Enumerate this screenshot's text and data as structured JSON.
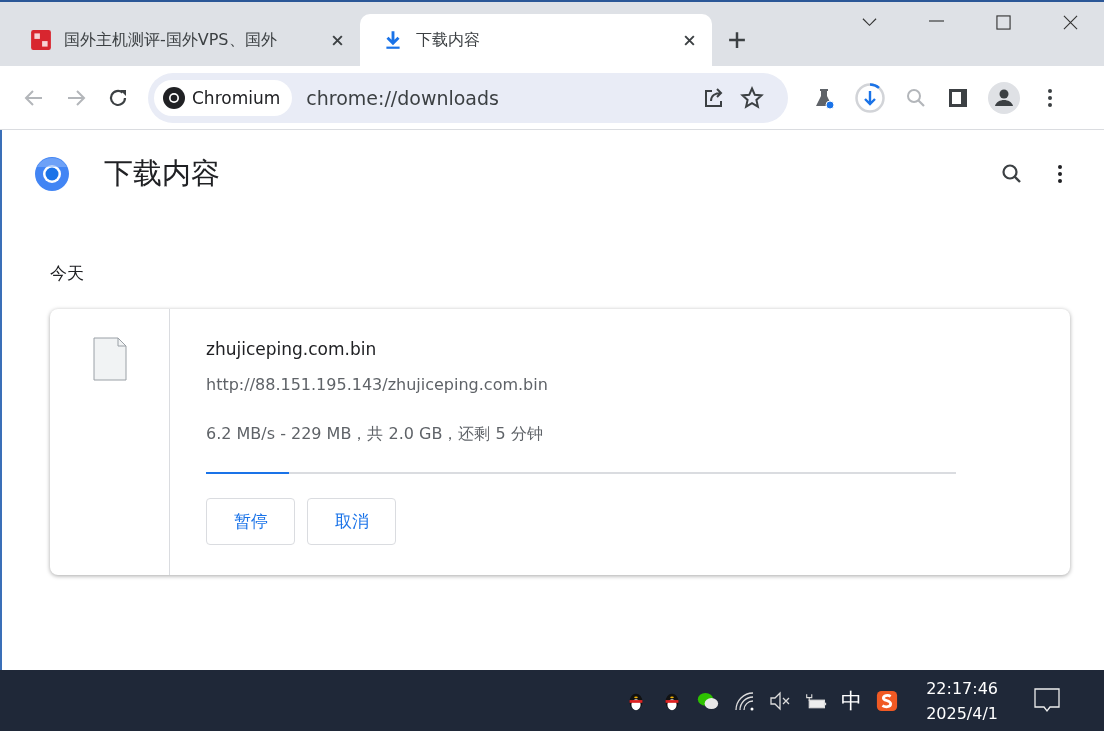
{
  "tabs": [
    {
      "title": "国外主机测评-国外VPS、国外",
      "selected": false,
      "kind": "site"
    },
    {
      "title": "下载内容",
      "selected": true,
      "kind": "download"
    }
  ],
  "toolbar": {
    "site_chip": "Chromium",
    "url": "chrome://downloads"
  },
  "page": {
    "title": "下载内容",
    "section": "今天",
    "downloads": [
      {
        "filename": "zhujiceping.com.bin",
        "url": "http://88.151.195.143/zhujiceping.com.bin",
        "status": "6.2 MB/s - 229 MB，共 2.0 GB，还剩 5 分钟",
        "level": 0.11,
        "buttons": [
          "暂停",
          "取消"
        ]
      }
    ]
  },
  "taskbar": {
    "ime": "中",
    "time": "22:17:46",
    "date": "2025/4/1"
  }
}
